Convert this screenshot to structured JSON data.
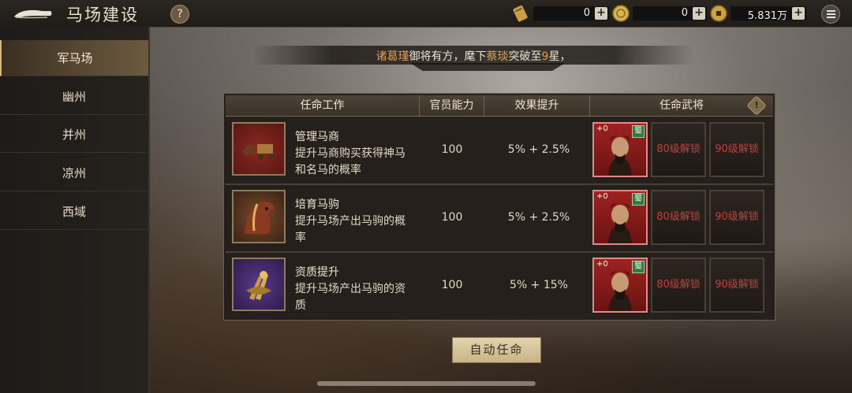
{
  "header": {
    "title": "马场建设",
    "help_label": "?",
    "resources": [
      {
        "icon": "scroll-icon",
        "value": "0",
        "plus": "+"
      },
      {
        "icon": "gold-coin-icon",
        "value": "0",
        "plus": "+"
      },
      {
        "icon": "copper-coin-icon",
        "value": "5.831万",
        "plus": "+"
      }
    ]
  },
  "sidebar": {
    "items": [
      {
        "label": "军马场",
        "active": true
      },
      {
        "label": "幽州"
      },
      {
        "label": "并州"
      },
      {
        "label": "凉州"
      },
      {
        "label": "西域"
      }
    ]
  },
  "banner": {
    "part1": "诸葛瑾",
    "part2": "御将有方，麾下",
    "part3": "蔡琰",
    "part4": "突破至",
    "part5": "9",
    "part6": "星，"
  },
  "table": {
    "headers": {
      "job": "任命工作",
      "ability": "官员能力",
      "effect": "效果提升",
      "general": "任命武将"
    },
    "rows": [
      {
        "name": "管理马商",
        "desc": "提升马商购买获得神马和名马的概率",
        "ability": "100",
        "effect": "5% + 2.5%",
        "general_level": "+0",
        "faction": "蜀",
        "lock1": "80级解锁",
        "lock2": "90级解锁"
      },
      {
        "name": "培育马驹",
        "desc": "提升马场产出马驹的概率",
        "ability": "100",
        "effect": "5% + 2.5%",
        "general_level": "+0",
        "faction": "蜀",
        "lock1": "80级解锁",
        "lock2": "90级解锁"
      },
      {
        "name": "资质提升",
        "desc": "提升马场产出马驹的资质",
        "ability": "100",
        "effect": "5% + 15%",
        "general_level": "+0",
        "faction": "蜀",
        "lock1": "80级解锁",
        "lock2": "90级解锁"
      }
    ]
  },
  "auto_button": "自动任命",
  "colors": {
    "highlight": "#e0a04a",
    "locked_text": "#c2413a",
    "faction_shu": "#2f7a3d"
  }
}
